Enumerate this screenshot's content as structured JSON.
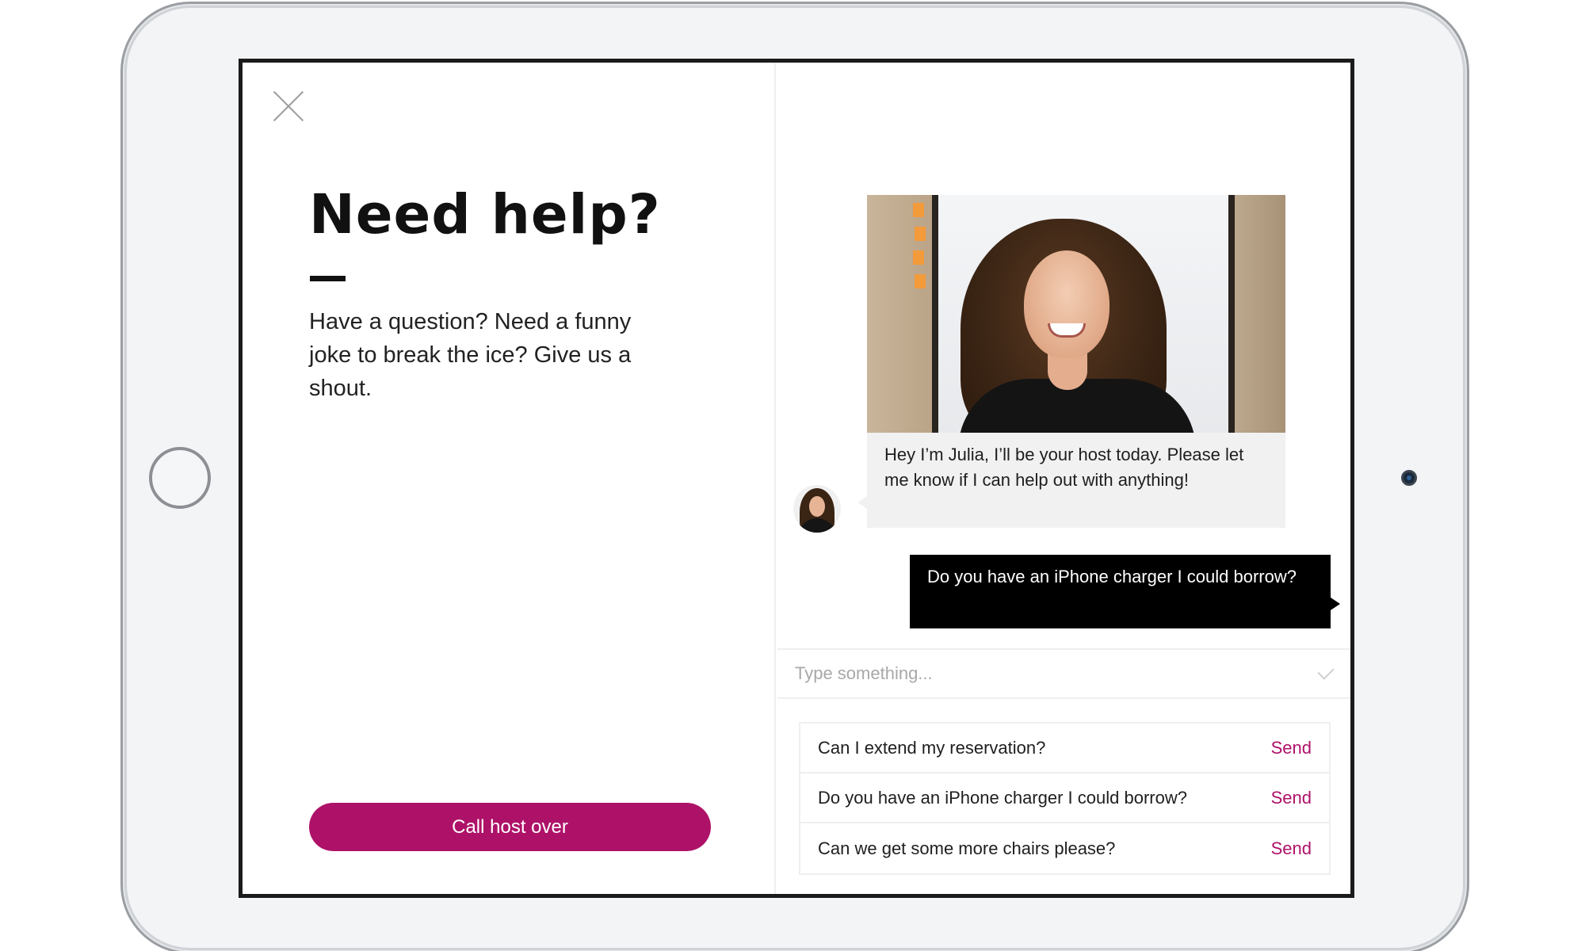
{
  "left": {
    "title": "Need help?",
    "intro": "Have a question? Need a funny joke to break the ice? Give us a shout.",
    "call_button": "Call host over"
  },
  "chat": {
    "host_message": "Hey I’m Julia, I’ll be your host today. Please let me know if I can help out with anything!",
    "user_message": "Do you have an iPhone charger I could borrow?",
    "composer_placeholder": "Type something..."
  },
  "suggestions": [
    {
      "text": "Can I extend my reservation?",
      "action": "Send"
    },
    {
      "text": "Do you have an iPhone charger I could borrow?",
      "action": "Send"
    },
    {
      "text": "Can we get some more chairs please?",
      "action": "Send"
    }
  ],
  "colors": {
    "accent": "#ae1268",
    "host_bubble": "#f1f1f1",
    "user_bubble": "#000000"
  },
  "icons": {
    "close": "close-icon",
    "send_check": "checkmark-icon"
  }
}
